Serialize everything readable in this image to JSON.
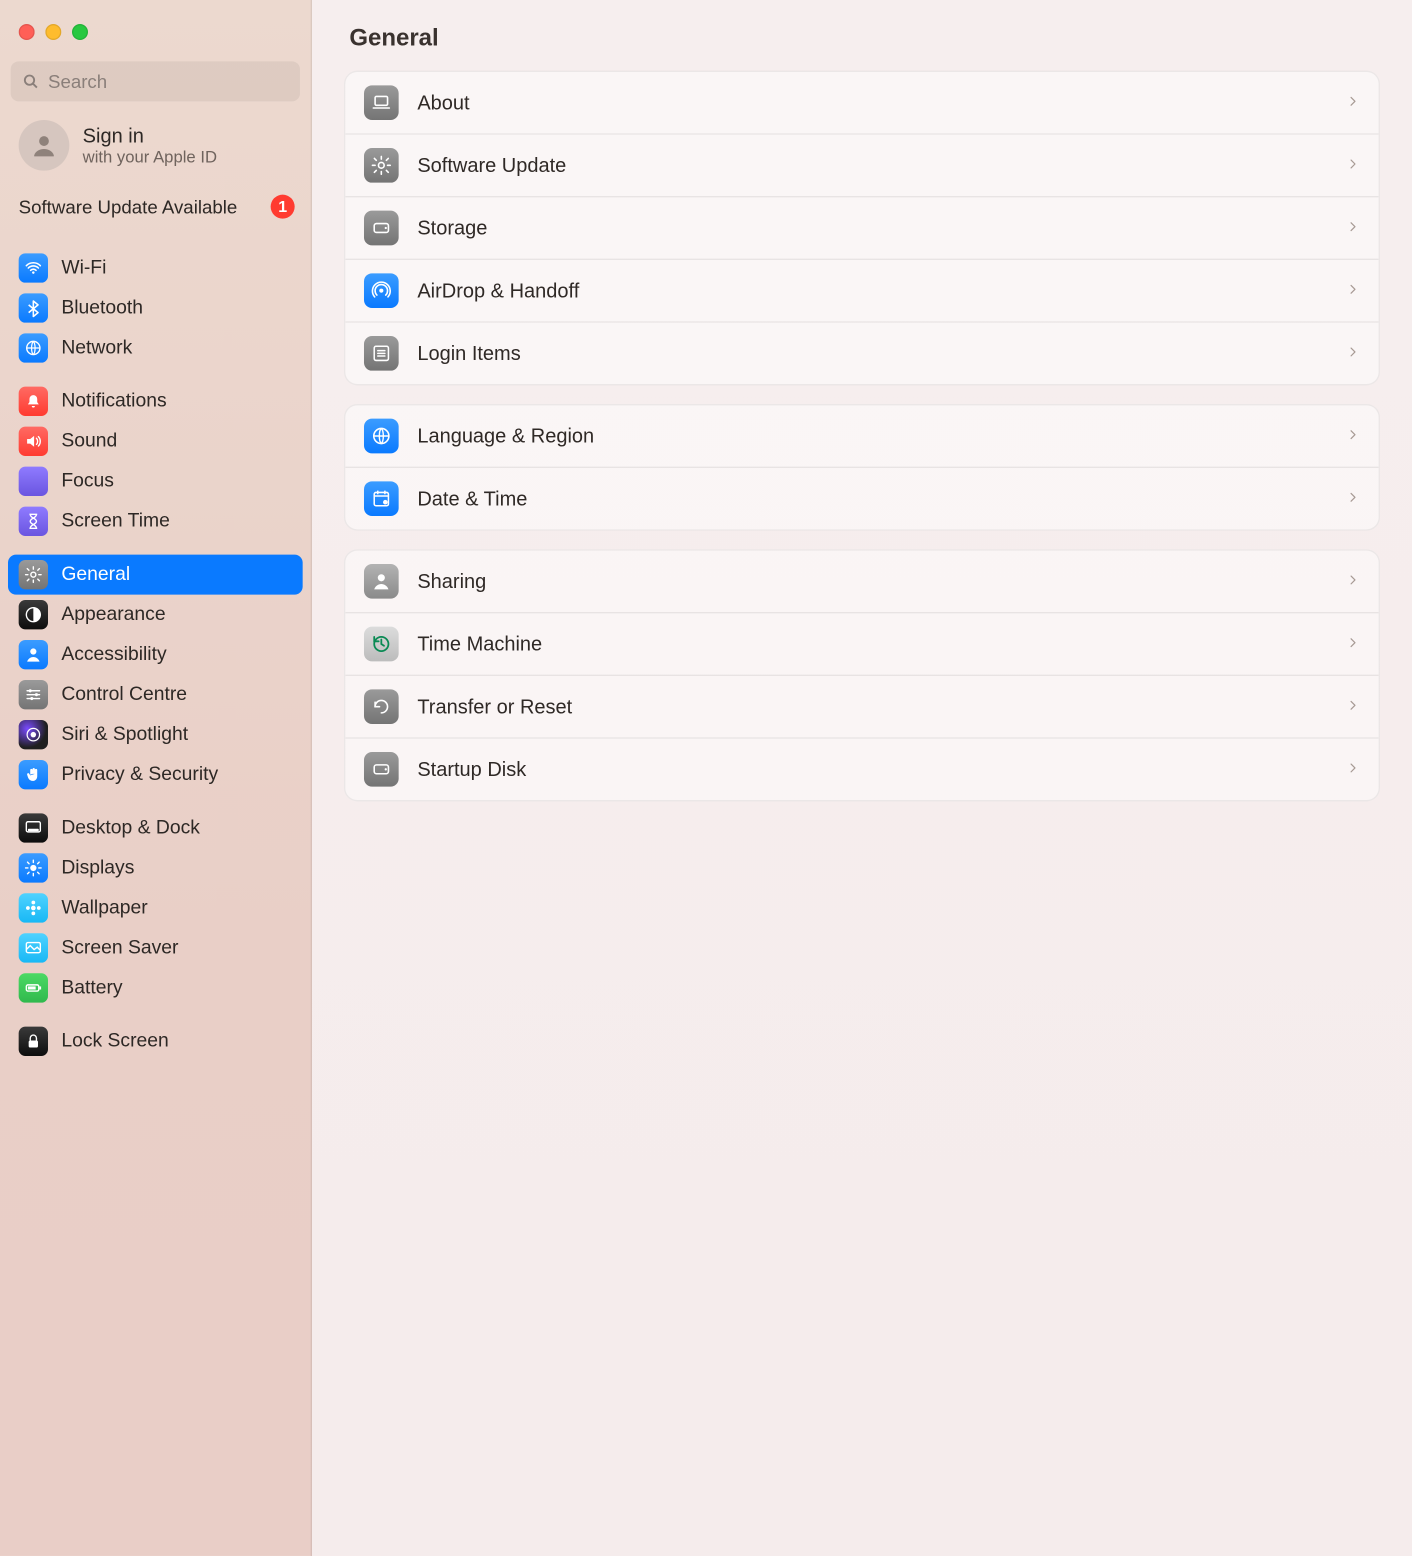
{
  "search": {
    "placeholder": "Search"
  },
  "signin": {
    "title": "Sign in",
    "subtitle": "with your Apple ID"
  },
  "promo": {
    "text": "Software Update Available",
    "badge": "1"
  },
  "sidebar": {
    "groups": [
      {
        "items": [
          {
            "id": "wifi",
            "label": "Wi-Fi",
            "icon": "wifi",
            "bg": "bg-blue"
          },
          {
            "id": "bluetooth",
            "label": "Bluetooth",
            "icon": "bluetooth",
            "bg": "bg-blue"
          },
          {
            "id": "network",
            "label": "Network",
            "icon": "globe",
            "bg": "bg-blue"
          }
        ]
      },
      {
        "items": [
          {
            "id": "notifications",
            "label": "Notifications",
            "icon": "bell",
            "bg": "bg-red"
          },
          {
            "id": "sound",
            "label": "Sound",
            "icon": "speaker",
            "bg": "bg-red"
          },
          {
            "id": "focus",
            "label": "Focus",
            "icon": "moon",
            "bg": "bg-purple"
          },
          {
            "id": "screentime",
            "label": "Screen Time",
            "icon": "hourglass",
            "bg": "bg-purple"
          }
        ]
      },
      {
        "items": [
          {
            "id": "general",
            "label": "General",
            "icon": "gear",
            "bg": "bg-gray",
            "selected": true
          },
          {
            "id": "appearance",
            "label": "Appearance",
            "icon": "contrast",
            "bg": "bg-black"
          },
          {
            "id": "accessibility",
            "label": "Accessibility",
            "icon": "person",
            "bg": "bg-blue"
          },
          {
            "id": "controlcentre",
            "label": "Control Centre",
            "icon": "sliders",
            "bg": "bg-gray"
          },
          {
            "id": "siri",
            "label": "Siri & Spotlight",
            "icon": "orb",
            "bg": "bg-siri"
          },
          {
            "id": "privacy",
            "label": "Privacy & Security",
            "icon": "hand",
            "bg": "bg-blue"
          }
        ]
      },
      {
        "items": [
          {
            "id": "desktopdock",
            "label": "Desktop & Dock",
            "icon": "dock",
            "bg": "bg-black"
          },
          {
            "id": "displays",
            "label": "Displays",
            "icon": "sun",
            "bg": "bg-blue"
          },
          {
            "id": "wallpaper",
            "label": "Wallpaper",
            "icon": "flower",
            "bg": "bg-cyan"
          },
          {
            "id": "screensaver",
            "label": "Screen Saver",
            "icon": "frame",
            "bg": "bg-cyan"
          },
          {
            "id": "battery",
            "label": "Battery",
            "icon": "battery",
            "bg": "bg-green"
          }
        ]
      },
      {
        "items": [
          {
            "id": "lockscreen",
            "label": "Lock Screen",
            "icon": "lock",
            "bg": "bg-black"
          }
        ]
      }
    ]
  },
  "page": {
    "title": "General",
    "groups": [
      {
        "rows": [
          {
            "id": "about",
            "label": "About",
            "icon": "laptop",
            "bg": "bg-gray"
          },
          {
            "id": "software-update",
            "label": "Software Update",
            "icon": "gear",
            "bg": "bg-gray"
          },
          {
            "id": "storage",
            "label": "Storage",
            "icon": "disk",
            "bg": "bg-gray"
          },
          {
            "id": "airdrop",
            "label": "AirDrop & Handoff",
            "icon": "airdrop",
            "bg": "bg-blue"
          },
          {
            "id": "login-items",
            "label": "Login Items",
            "icon": "list",
            "bg": "bg-gray"
          }
        ]
      },
      {
        "rows": [
          {
            "id": "language",
            "label": "Language & Region",
            "icon": "globe",
            "bg": "bg-blue"
          },
          {
            "id": "datetime",
            "label": "Date & Time",
            "icon": "calendar",
            "bg": "bg-blue"
          }
        ]
      },
      {
        "rows": [
          {
            "id": "sharing",
            "label": "Sharing",
            "icon": "person",
            "bg": "bg-gray2"
          },
          {
            "id": "timemachine",
            "label": "Time Machine",
            "icon": "clockback",
            "bg": "bg-tm"
          },
          {
            "id": "transfer",
            "label": "Transfer or Reset",
            "icon": "reset",
            "bg": "bg-gray"
          },
          {
            "id": "startup",
            "label": "Startup Disk",
            "icon": "disk",
            "bg": "bg-gray"
          }
        ]
      }
    ]
  }
}
